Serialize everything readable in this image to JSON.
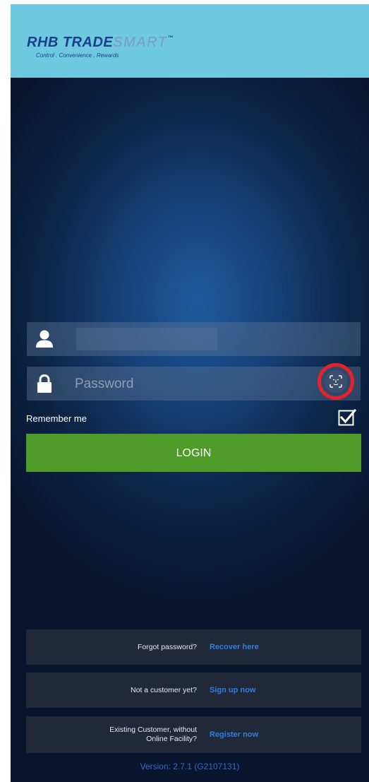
{
  "header": {
    "logo_rhb": "RHB",
    "logo_trade": "TRADE",
    "logo_smart": "SMART",
    "logo_tm": "™",
    "tagline": "Control . Convenience . Rewards",
    "background": "#6ec8e0"
  },
  "login_form": {
    "username_icon": "user-icon",
    "username_value": "",
    "password_icon": "lock-icon",
    "password_placeholder": "Password",
    "faceid_icon": "face-id-icon",
    "remember_label": "Remember me",
    "remember_checked": true,
    "login_label": "LOGIN",
    "login_color": "#4f9b2a"
  },
  "links": {
    "forgot_text": "Forgot password?",
    "forgot_action": "Recover here",
    "signup_text": "Not a customer yet?",
    "signup_action": "Sign up now",
    "register_text_line1": "Existing Customer, without",
    "register_text_line2": "Online Facility?",
    "register_action": "Register now",
    "action_color": "#2f7fe0"
  },
  "version": "Version: 2.7.1 (G2107131)",
  "highlight_color": "#e3222c"
}
